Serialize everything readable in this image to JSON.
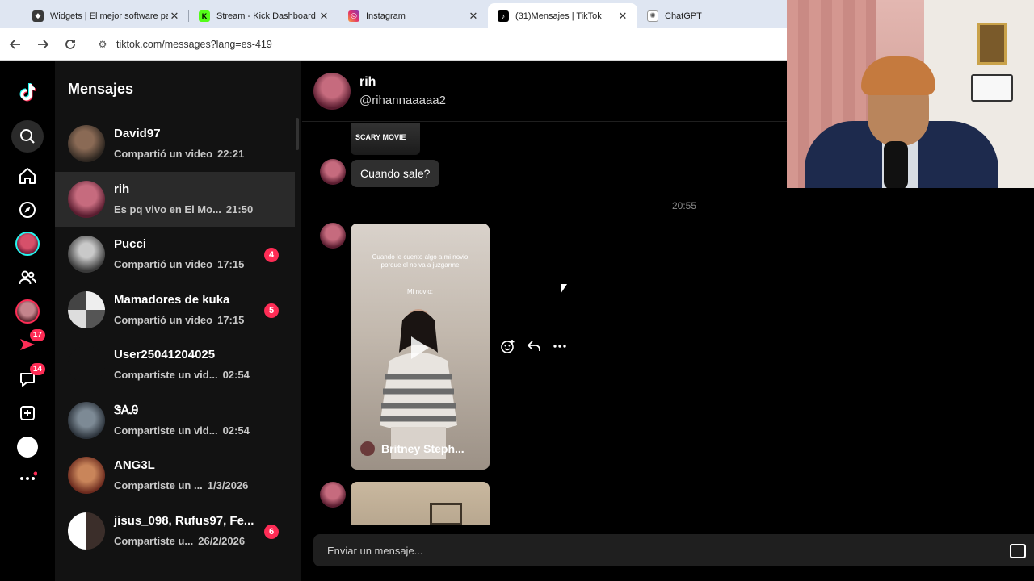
{
  "browser": {
    "tabs": [
      {
        "title": "Widgets | El mejor software par",
        "favicon": "widgets-favicon",
        "color": "#4a4a4a"
      },
      {
        "title": "Stream - Kick Dashboard",
        "favicon": "kick-favicon",
        "color": "#53fc18"
      },
      {
        "title": "Instagram",
        "favicon": "instagram-favicon",
        "color": "#e1306c"
      },
      {
        "title": "(31)Mensajes | TikTok",
        "favicon": "tiktok-favicon",
        "color": "#000000"
      },
      {
        "title": "ChatGPT",
        "favicon": "chatgpt-favicon",
        "color": "#666666"
      }
    ],
    "url": "tiktok.com/messages?lang=es-419"
  },
  "sidebar": {
    "badges": {
      "activity": "17",
      "messages": "14"
    }
  },
  "inbox": {
    "title": "Mensajes",
    "conversations": [
      {
        "name": "David97",
        "preview": "Compartió un video",
        "time": "22:21",
        "badge": ""
      },
      {
        "name": "rih",
        "preview": "Es pq vivo en El Mo...",
        "time": "21:50",
        "badge": ""
      },
      {
        "name": "Pucci",
        "preview": "Compartió un video",
        "time": "17:15",
        "badge": "4"
      },
      {
        "name": "Mamadores de kuka",
        "preview": "Compartió un video",
        "time": "17:15",
        "badge": "5"
      },
      {
        "name": "User25041204025",
        "preview": "Compartiste un vid...",
        "time": "02:54",
        "badge": ""
      },
      {
        "name": "ᏕᎪᎯ",
        "preview": "Compartiste un vid...",
        "time": "02:54",
        "badge": ""
      },
      {
        "name": "ANG3L",
        "preview": "Compartiste un ...",
        "time": "1/3/2026",
        "badge": ""
      },
      {
        "name": "jisus_098, Rufus97, Fe...",
        "preview": "Compartiste u...",
        "time": "26/2/2026",
        "badge": "6"
      }
    ]
  },
  "chat": {
    "name": "rih",
    "username": "@rihannaaaaa2",
    "thumb_label": "SCARY MOVIE",
    "message": "Cuando sale?",
    "time_separator": "20:55",
    "video_caption": "Cuando le cuento algo a mi novio porque el no va a juzgarme",
    "video_caption2": "Mi novio:",
    "video_author": "Britney Steph...",
    "composer_placeholder": "Enviar un mensaje..."
  },
  "colors": {
    "accent": "#fe2c55",
    "cyan": "#25f4ee"
  }
}
